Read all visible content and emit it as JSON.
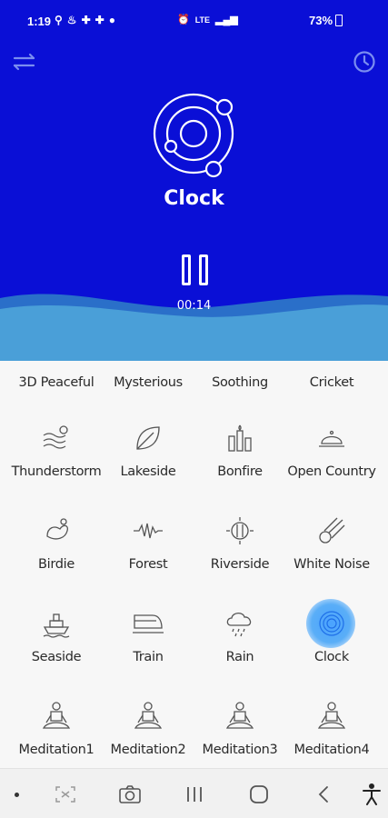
{
  "status_bar": {
    "time": "1:19",
    "network": "LTE",
    "battery": "73%"
  },
  "header": {
    "now_playing": "Clock",
    "elapsed": "00:14"
  },
  "sounds": [
    [
      "3D Peaceful",
      "Mysterious",
      "Soothing",
      "Cricket"
    ],
    [
      "Thunderstorm",
      "Lakeside",
      "Bonfire",
      "Open Country"
    ],
    [
      "Birdie",
      "Forest",
      "Riverside",
      "White Noise"
    ],
    [
      "Seaside",
      "Train",
      "Rain",
      "Clock"
    ],
    [
      "Meditation1",
      "Meditation2",
      "Meditation3",
      "Meditation4"
    ]
  ],
  "active_sound": "Clock",
  "colors": {
    "primary": "#0a0fd6",
    "wave": "#4a9fd8",
    "accent": "#4aa3ff"
  }
}
